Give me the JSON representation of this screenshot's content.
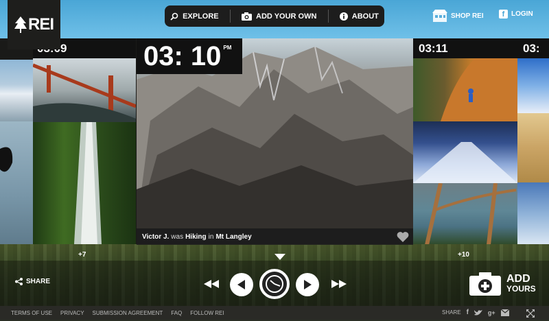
{
  "brand": {
    "logo_text": "REI"
  },
  "nav": {
    "explore": "EXPLORE",
    "add_your_own": "ADD YOUR OWN",
    "about": "ABOUT"
  },
  "header": {
    "shop": "SHOP REI",
    "login": "LOGIN"
  },
  "timeline": {
    "times": [
      "03:09",
      "03:10",
      "03:11",
      "03:"
    ],
    "featured_time": "03: 10",
    "featured_meridiem": "PM",
    "more_left": "+7",
    "more_right": "+10"
  },
  "caption": {
    "user": "Victor J.",
    "was": "was",
    "activity": "Hiking",
    "in": "in",
    "place": "Mt Langley"
  },
  "controls": {
    "share": "SHARE",
    "add_line1": "ADD",
    "add_line2": "YOURS"
  },
  "footer": {
    "links": [
      "TERMS OF USE",
      "PRIVACY",
      "SUBMISSION AGREEMENT",
      "FAQ",
      "FOLLOW REI"
    ],
    "share_label": "SHARE"
  }
}
